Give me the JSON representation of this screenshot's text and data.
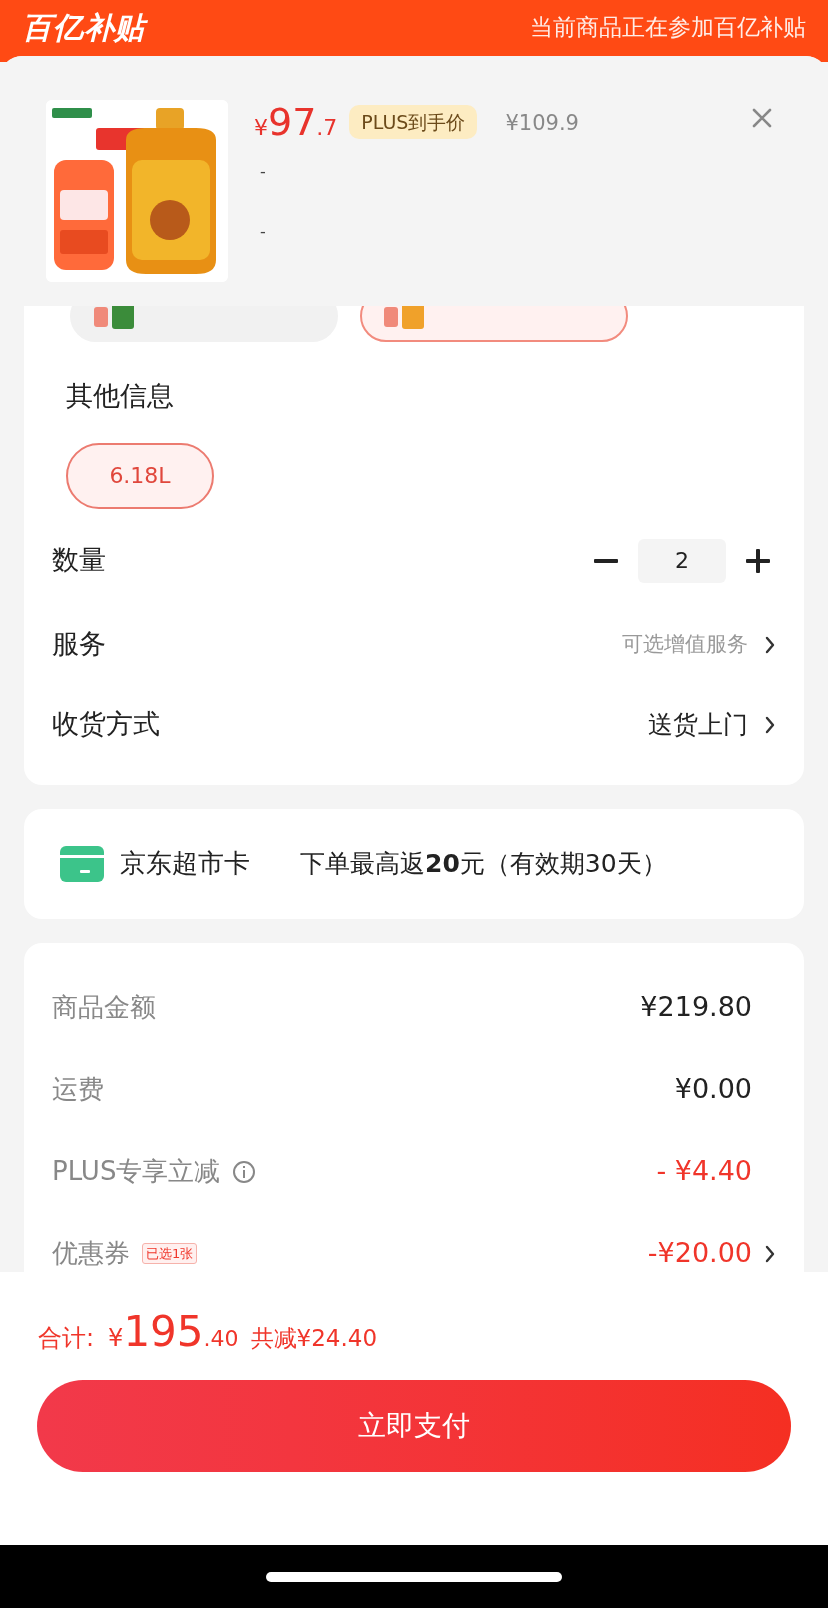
{
  "header": {
    "logo": "百亿补贴",
    "notice": "当前商品正在参加百亿补贴"
  },
  "product": {
    "price_symbol": "¥",
    "price_main": "97",
    "price_decimal": ".7",
    "price_tag": "PLUS到手价",
    "original_price": "¥109.9",
    "lines": [
      "-",
      "-"
    ]
  },
  "variant_chips": [
    {
      "selected": false
    },
    {
      "selected": true
    }
  ],
  "other_info": {
    "title": "其他信息",
    "options": [
      {
        "label": "6.18L",
        "selected": true
      }
    ]
  },
  "quantity": {
    "label": "数量",
    "value": "2"
  },
  "rows": [
    {
      "label": "服务",
      "value": "可选增值服务",
      "muted": true
    },
    {
      "label": "收货方式",
      "value": "送货上门",
      "muted": false
    }
  ],
  "card": {
    "name": "京东超市卡",
    "text": "下单最高返**20**元（有效期30天）"
  },
  "summary": [
    {
      "label": "商品金额",
      "value": "¥219.80",
      "kind": "plain"
    },
    {
      "label": "运费",
      "value": "¥0.00",
      "kind": "plain"
    },
    {
      "label": "PLUS专享立减",
      "value": "- ¥4.40",
      "kind": "discount",
      "info": true
    },
    {
      "label": "优惠券",
      "badge": "已选1张",
      "value": "-¥20.00",
      "kind": "discount",
      "link": true
    }
  ],
  "total": {
    "label": "合计:",
    "symbol": "¥",
    "main": "195",
    "decimal": ".40",
    "saved": "共减¥24.40"
  },
  "pay_button": "立即支付"
}
